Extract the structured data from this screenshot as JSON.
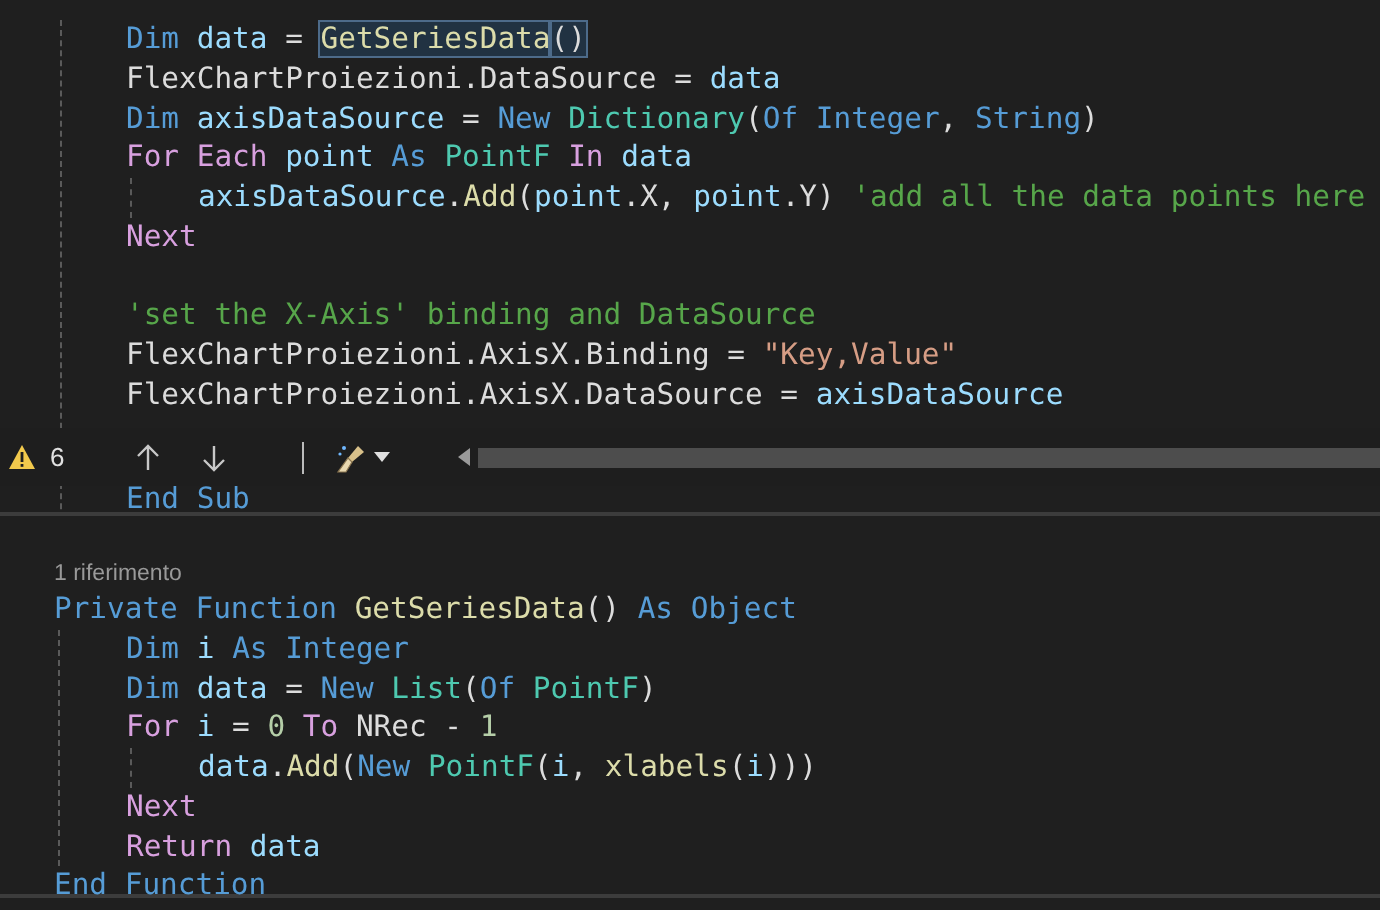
{
  "top_pane": {
    "lines": [
      {
        "tokens": [
          {
            "kind": "kw",
            "text": "Dim ",
            "highlighted": false
          },
          {
            "kind": "var",
            "text": "data",
            "highlighted": false
          },
          {
            "kind": "txt",
            "text": " = ",
            "highlighted": false
          },
          {
            "kind": "fn",
            "text": "GetSeriesData",
            "highlighted": true
          },
          {
            "kind": "txt",
            "text": "()",
            "highlighted": true
          }
        ]
      },
      {
        "tokens": [
          {
            "kind": "txt",
            "text": "FlexChartProiezioni.DataSource = "
          },
          {
            "kind": "var",
            "text": "data"
          }
        ]
      },
      {
        "tokens": [
          {
            "kind": "kw",
            "text": "Dim "
          },
          {
            "kind": "var",
            "text": "axisDataSource"
          },
          {
            "kind": "txt",
            "text": " = "
          },
          {
            "kind": "kw",
            "text": "New "
          },
          {
            "kind": "type",
            "text": "Dictionary"
          },
          {
            "kind": "txt",
            "text": "("
          },
          {
            "kind": "kw",
            "text": "Of Integer"
          },
          {
            "kind": "txt",
            "text": ", "
          },
          {
            "kind": "kw",
            "text": "String"
          },
          {
            "kind": "txt",
            "text": ")"
          }
        ]
      },
      {
        "tokens": [
          {
            "kind": "ctl",
            "text": "For Each "
          },
          {
            "kind": "var",
            "text": "point "
          },
          {
            "kind": "kw",
            "text": "As "
          },
          {
            "kind": "type",
            "text": "PointF "
          },
          {
            "kind": "ctl",
            "text": "In "
          },
          {
            "kind": "var",
            "text": "data"
          }
        ],
        "children": [
          {
            "tokens": [
              {
                "kind": "var",
                "text": "axisDataSource"
              },
              {
                "kind": "txt",
                "text": "."
              },
              {
                "kind": "fn",
                "text": "Add"
              },
              {
                "kind": "txt",
                "text": "("
              },
              {
                "kind": "var",
                "text": "point"
              },
              {
                "kind": "txt",
                "text": ".X, "
              },
              {
                "kind": "var",
                "text": "point"
              },
              {
                "kind": "txt",
                "text": ".Y) "
              },
              {
                "kind": "cmt",
                "text": "'add all the data points here"
              }
            ]
          }
        ]
      },
      {
        "tokens": [
          {
            "kind": "ctl",
            "text": "Next"
          }
        ]
      },
      {
        "kind": "blank"
      },
      {
        "tokens": [
          {
            "kind": "cmt",
            "text": "'set the X-Axis' binding and DataSource"
          }
        ]
      },
      {
        "tokens": [
          {
            "kind": "txt",
            "text": "FlexChartProiezioni.AxisX.Binding = "
          },
          {
            "kind": "str",
            "text": "\"Key,Value\""
          }
        ]
      },
      {
        "tokens": [
          {
            "kind": "txt",
            "text": "FlexChartProiezioni.AxisX.DataSource = "
          },
          {
            "kind": "var",
            "text": "axisDataSource"
          }
        ]
      }
    ],
    "end_line": {
      "tokens": [
        {
          "kind": "kw",
          "text": "End Sub"
        }
      ]
    }
  },
  "toolbar": {
    "warning_count": "6"
  },
  "bottom_pane": {
    "code_lens": "1 riferimento",
    "header": {
      "tokens": [
        {
          "kind": "kw",
          "text": "Private Function "
        },
        {
          "kind": "fn",
          "text": "GetSeriesData"
        },
        {
          "kind": "txt",
          "text": "() "
        },
        {
          "kind": "kw",
          "text": "As Object"
        }
      ],
      "children": [
        {
          "tokens": [
            {
              "kind": "kw",
              "text": "Dim "
            },
            {
              "kind": "var",
              "text": "i "
            },
            {
              "kind": "kw",
              "text": "As Integer"
            }
          ]
        },
        {
          "tokens": [
            {
              "kind": "kw",
              "text": "Dim "
            },
            {
              "kind": "var",
              "text": "data"
            },
            {
              "kind": "txt",
              "text": " = "
            },
            {
              "kind": "kw",
              "text": "New "
            },
            {
              "kind": "type",
              "text": "List"
            },
            {
              "kind": "txt",
              "text": "("
            },
            {
              "kind": "kw",
              "text": "Of "
            },
            {
              "kind": "type",
              "text": "PointF"
            },
            {
              "kind": "txt",
              "text": ")"
            }
          ]
        },
        {
          "tokens": [
            {
              "kind": "ctl",
              "text": "For "
            },
            {
              "kind": "var",
              "text": "i"
            },
            {
              "kind": "txt",
              "text": " = "
            },
            {
              "kind": "num",
              "text": "0"
            },
            {
              "kind": "ctl",
              "text": " To "
            },
            {
              "kind": "txt",
              "text": "NRec - "
            },
            {
              "kind": "num",
              "text": "1"
            }
          ],
          "children": [
            {
              "tokens": [
                {
                  "kind": "var",
                  "text": "data"
                },
                {
                  "kind": "txt",
                  "text": "."
                },
                {
                  "kind": "fn",
                  "text": "Add"
                },
                {
                  "kind": "txt",
                  "text": "("
                },
                {
                  "kind": "kw",
                  "text": "New "
                },
                {
                  "kind": "type",
                  "text": "PointF"
                },
                {
                  "kind": "txt",
                  "text": "("
                },
                {
                  "kind": "var",
                  "text": "i"
                },
                {
                  "kind": "txt",
                  "text": ", "
                },
                {
                  "kind": "fn",
                  "text": "xlabels"
                },
                {
                  "kind": "txt",
                  "text": "("
                },
                {
                  "kind": "var",
                  "text": "i"
                },
                {
                  "kind": "txt",
                  "text": ")))"
                }
              ]
            }
          ]
        },
        {
          "tokens": [
            {
              "kind": "ctl",
              "text": "Next"
            }
          ]
        },
        {
          "tokens": [
            {
              "kind": "ctl",
              "text": "Return "
            },
            {
              "kind": "var",
              "text": "data"
            }
          ]
        }
      ]
    },
    "end_line": {
      "tokens": [
        {
          "kind": "kw",
          "text": "End Function"
        }
      ]
    }
  }
}
